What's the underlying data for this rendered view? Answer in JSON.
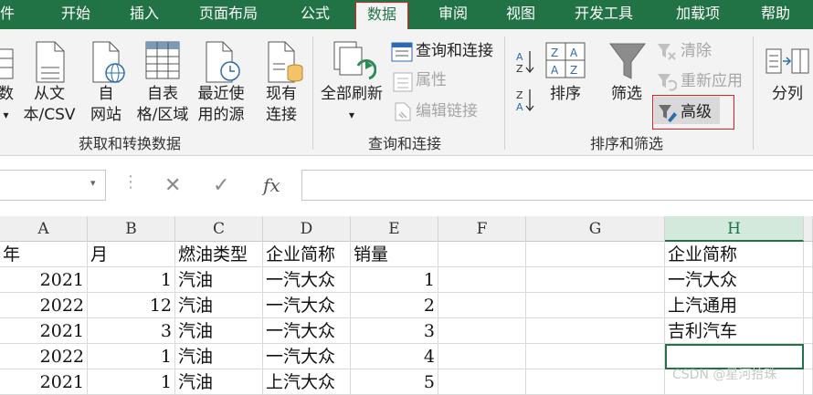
{
  "tabs": [
    "件",
    "开始",
    "插入",
    "页面布局",
    "公式",
    "数据",
    "审阅",
    "视图",
    "开发工具",
    "加载项",
    "帮助"
  ],
  "ribbon": {
    "get_data": {
      "label": "获取和转换数据",
      "btn_partial": "数",
      "btn_text_csv": [
        "从文",
        "本/CSV"
      ],
      "btn_web": [
        "自",
        "网站"
      ],
      "btn_table": [
        "自表",
        "格/区域"
      ],
      "btn_recent": [
        "最近使",
        "用的源"
      ],
      "btn_existing": [
        "现有",
        "连接"
      ]
    },
    "queries": {
      "label": "查询和连接",
      "btn_refresh": "全部刷新",
      "queries_connections": "查询和连接",
      "properties": "属性",
      "edit_links": "编辑链接"
    },
    "sort_filter": {
      "label": "排序和筛选",
      "sort": "排序",
      "filter": "筛选",
      "clear": "清除",
      "reapply": "重新应用",
      "advanced": "高级"
    },
    "tools": {
      "split": "分列"
    }
  },
  "formula_bar": {
    "cancel": "✕",
    "enter": "✓",
    "fx": "fx",
    "value": ""
  },
  "columns": [
    "A",
    "B",
    "C",
    "D",
    "E",
    "F",
    "G",
    "H"
  ],
  "rows": [
    [
      "年",
      "月",
      "燃油类型",
      "企业简称",
      "销量",
      "",
      "",
      "企业简称"
    ],
    [
      "2021",
      "1",
      "汽油",
      "一汽大众",
      "1",
      "",
      "",
      "一汽大众"
    ],
    [
      "2022",
      "12",
      "汽油",
      "一汽大众",
      "2",
      "",
      "",
      "上汽通用"
    ],
    [
      "2021",
      "3",
      "汽油",
      "一汽大众",
      "3",
      "",
      "",
      "吉利汽车"
    ],
    [
      "2022",
      "1",
      "汽油",
      "一汽大众",
      "4",
      "",
      "",
      ""
    ],
    [
      "2021",
      "1",
      "汽油",
      "上汽大众",
      "5",
      "",
      "",
      ""
    ]
  ],
  "watermark": "CSDN @星河拾珠",
  "colors": {
    "brand": "#217346",
    "highlight_border": "#e02020"
  }
}
